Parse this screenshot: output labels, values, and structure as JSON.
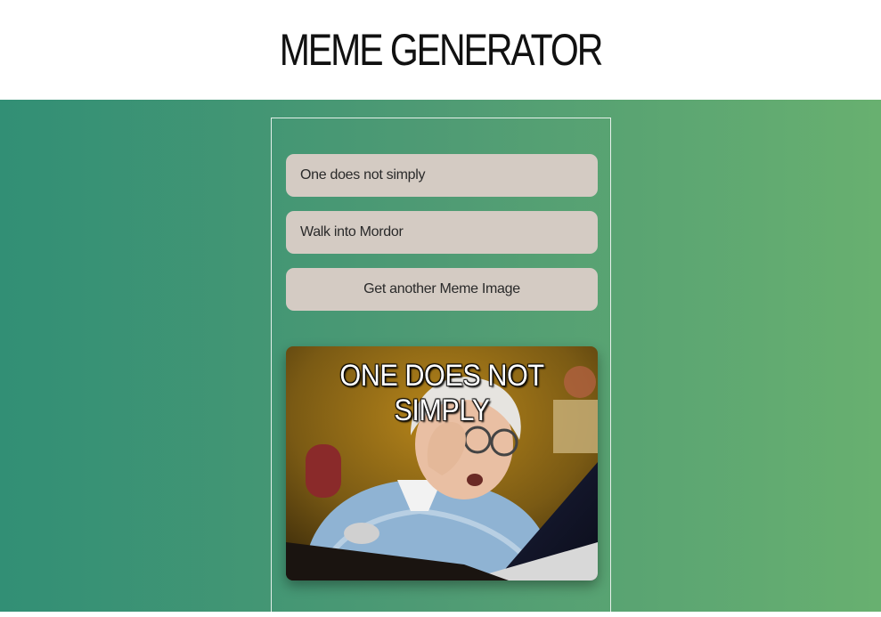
{
  "header": {
    "title": "MEME GENERATOR"
  },
  "form": {
    "top_text_value": "One does not simply",
    "bottom_text_value": "Walk into Mordor",
    "get_button_label": "Get another Meme Image"
  },
  "meme": {
    "top_text": "ONE DOES NOT SIMPLY",
    "bottom_text": "",
    "image": "grandma-laptop-meme-image"
  },
  "colors": {
    "gradient_left": "#328f75",
    "gradient_right": "#68b070",
    "field_bg": "#d4cbc3"
  }
}
